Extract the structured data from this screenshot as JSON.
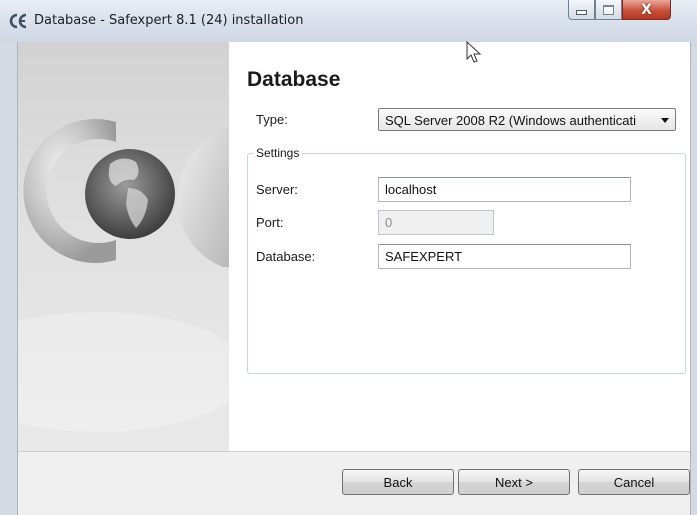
{
  "window": {
    "title": "Database - Safexpert 8.1 (24) installation",
    "close_label": "X"
  },
  "page": {
    "heading": "Database",
    "type_label": "Type:",
    "type_value": "SQL Server 2008 R2 (Windows authenticati",
    "settings_title": "Settings",
    "server_label": "Server:",
    "server_value": "localhost",
    "port_label": "Port:",
    "port_value": "0",
    "database_label": "Database:",
    "database_value": "SAFEXPERT"
  },
  "buttons": {
    "back": "Back",
    "next": "Next >",
    "cancel": "Cancel"
  },
  "colors": {
    "title_bar": "#d7dfea",
    "close_button": "#c8503a",
    "group_border": "#c7d4e2"
  },
  "icons": [
    "ce-logo-icon",
    "globe-logo-icon",
    "minimize-icon",
    "maximize-icon",
    "close-icon",
    "mouse-pointer-icon",
    "dropdown-arrow-icon"
  ]
}
